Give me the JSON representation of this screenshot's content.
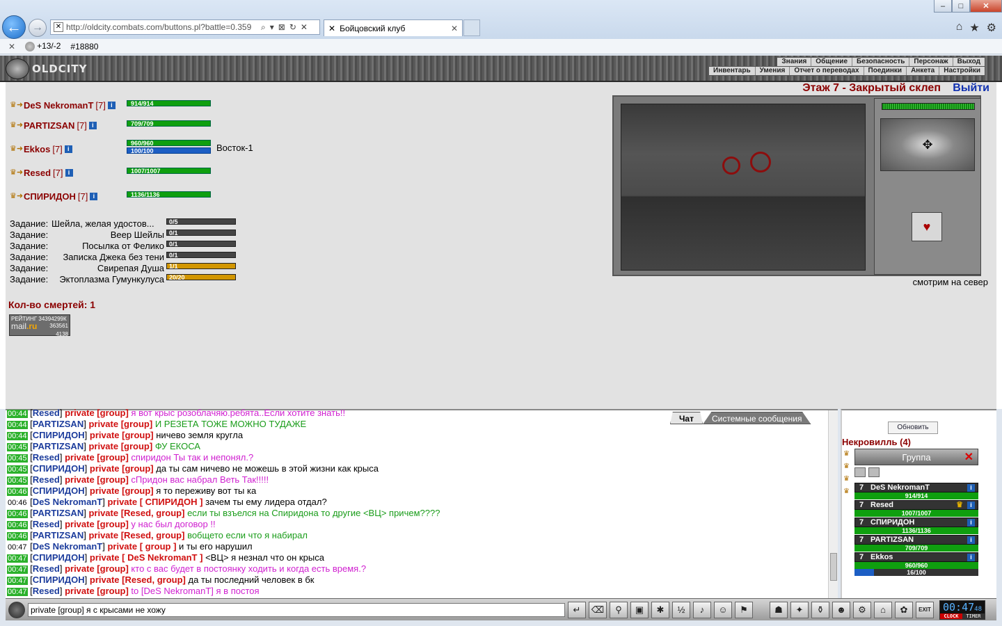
{
  "browser": {
    "url": "http://oldcity.combats.com/buttons.pl?battle=0.359",
    "tab_title": "Бойцовский клуб",
    "cmd_text": "+13/-2",
    "cmd_id": "#18880",
    "win_min": "–",
    "win_max": "□",
    "win_close": "✕"
  },
  "header": {
    "logo": "OLDCITY",
    "menu_top": [
      "Знания",
      "Общение",
      "Безопасность",
      "Персонаж",
      "Выход"
    ],
    "menu_bottom": [
      "Инвентарь",
      "Умения",
      "Отчет о переводах",
      "Поединки",
      "Анкета",
      "Настройки"
    ]
  },
  "party": [
    {
      "name": "DeS NekromanT",
      "level": "[7]",
      "hp": "914/914"
    },
    {
      "name": "PARTIZSAN",
      "level": "[7]",
      "hp": "709/709"
    },
    {
      "name": "Ekkos",
      "level": "[7]",
      "hp": "960/960",
      "mp": "100/100",
      "location": "Восток-1"
    },
    {
      "name": "Resed",
      "level": "[7]",
      "hp": "1007/1007"
    },
    {
      "name": "СПИРИДОН",
      "level": "[7]",
      "hp": "1136/1136"
    }
  ],
  "quests": [
    {
      "label": "Задание:",
      "name": "Шейла, желая удостов...",
      "progress": "0/5",
      "fraction": 0
    },
    {
      "label": "Задание:",
      "name": "Веер Шейлы",
      "progress": "0/1",
      "fraction": 0
    },
    {
      "label": "Задание:",
      "name": "Посылка от Фелико",
      "progress": "0/1",
      "fraction": 0
    },
    {
      "label": "Задание:",
      "name": "Записка Джека без тени",
      "progress": "0/1",
      "fraction": 0
    },
    {
      "label": "Задание:",
      "name": "Свирепая Душа",
      "progress": "1/1",
      "fraction": 1
    },
    {
      "label": "Задание:",
      "name": "Эктоплазма Гумункулуса",
      "progress": "20/20",
      "fraction": 1
    }
  ],
  "deaths": "Кол-во смертей: 1",
  "rating": {
    "line1": "РЕЙТИНГ 34394299К",
    "mail_a": "mail",
    "mail_b": ".ru",
    "n1": "363561",
    "n2": "4138"
  },
  "dungeon": {
    "title": "Этаж 7 - Закрытый склеп",
    "exit": "Выйти",
    "direction": "смотрим на север"
  },
  "chat": {
    "tabs": {
      "chat": "Чат",
      "system": "Системные сообщения"
    },
    "messages": [
      {
        "time": "00:44",
        "hl": true,
        "sender": "Resed",
        "scope": "private [group]",
        "text": "я вот крыс розоблачяю.ребята..Если хотите знать!!",
        "color": "pink"
      },
      {
        "time": "00:44",
        "hl": true,
        "sender": "PARTIZSAN",
        "scope": "private [group]",
        "text": "И РЕЗЕТА ТОЖЕ МОЖНО ТУДАЖЕ",
        "color": "green"
      },
      {
        "time": "00:44",
        "hl": true,
        "sender": "СПИРИДОН",
        "scope": "private [group]",
        "text": "ничево земля кругла",
        "color": "black"
      },
      {
        "time": "00:45",
        "hl": true,
        "sender": "PARTIZSAN",
        "scope": "private [group]",
        "text": "ФУ ЕКОСА",
        "color": "green"
      },
      {
        "time": "00:45",
        "hl": true,
        "sender": "Resed",
        "scope": "private [group]",
        "text": "спиридон Ты так и непонял.?",
        "color": "pink"
      },
      {
        "time": "00:45",
        "hl": true,
        "sender": "СПИРИДОН",
        "scope": "private [group]",
        "text": "да ты сам ничево не можешь в этой жизни как крыса",
        "color": "black"
      },
      {
        "time": "00:45",
        "hl": true,
        "sender": "Resed",
        "scope": "private [group]",
        "text": "сПридон вас набрал Веть Так!!!!!",
        "color": "pink"
      },
      {
        "time": "00:46",
        "hl": true,
        "sender": "СПИРИДОН",
        "scope": "private [group]",
        "text": "я то переживу вот ты ка",
        "color": "black"
      },
      {
        "time": "00:46",
        "hl": false,
        "sender": "DeS NekromanT",
        "scope": "private [ СПИРИДОН ]",
        "text": "зачем ты ему лидера отдал?",
        "color": "black"
      },
      {
        "time": "00:46",
        "hl": true,
        "sender": "PARTIZSAN",
        "scope": "private [Resed, group]",
        "text": "если ты взъелся на Спиридона то другие <ВЦ> причем????",
        "color": "green"
      },
      {
        "time": "00:46",
        "hl": true,
        "sender": "Resed",
        "scope": "private [group]",
        "text": "у нас был договор !!",
        "color": "pink"
      },
      {
        "time": "00:46",
        "hl": true,
        "sender": "PARTIZSAN",
        "scope": "private [Resed, group]",
        "text": "вобщето если что я набирал",
        "color": "green"
      },
      {
        "time": "00:47",
        "hl": false,
        "sender": "DeS NekromanT",
        "scope": "private [ group ]",
        "text": "и ты его нарушил",
        "color": "black"
      },
      {
        "time": "00:47",
        "hl": true,
        "sender": "СПИРИДОН",
        "scope": "private [ DeS NekromanT ]",
        "text": "<ВЦ> я незнал что он крыса",
        "color": "black"
      },
      {
        "time": "00:47",
        "hl": true,
        "sender": "Resed",
        "scope": "private [group]",
        "text": "кто с вас будет в постоянку ходить и когда есть время.?",
        "color": "pink"
      },
      {
        "time": "00:47",
        "hl": true,
        "sender": "СПИРИДОН",
        "scope": "private [Resed, group]",
        "text": "да ты последний человек в бк",
        "color": "black"
      },
      {
        "time": "00:47",
        "hl": true,
        "sender": "Resed",
        "scope": "private [group]",
        "text": "to [DeS NekromanT] я в постоя",
        "color": "pink"
      }
    ],
    "input": "private [group] я с крысами не хожу"
  },
  "group_panel": {
    "refresh": "Обновить",
    "location": "Некровилль (4)",
    "title": "Группа",
    "members": [
      {
        "level": "7",
        "name": "DeS NekromanT",
        "hp": "914/914"
      },
      {
        "level": "7",
        "name": "Resed",
        "hp": "1007/1007",
        "leader": true
      },
      {
        "level": "7",
        "name": "СПИРИДОН",
        "hp": "1136/1136"
      },
      {
        "level": "7",
        "name": "PARTIZSAN",
        "hp": "709/709"
      },
      {
        "level": "7",
        "name": "Ekkos",
        "hp": "960/960",
        "mp": "16/100",
        "mp_fraction": 0.16
      }
    ]
  },
  "clock": {
    "time": "00:47",
    "sec": "48",
    "label_a": "CLOCK",
    "label_b": "TIMER",
    "exit": "EXIT"
  },
  "colors": {
    "hp": "#0f9f0f",
    "mp": "#1c5ec4",
    "player_name": "#8b0000",
    "time_bg": "#2bb12b"
  }
}
